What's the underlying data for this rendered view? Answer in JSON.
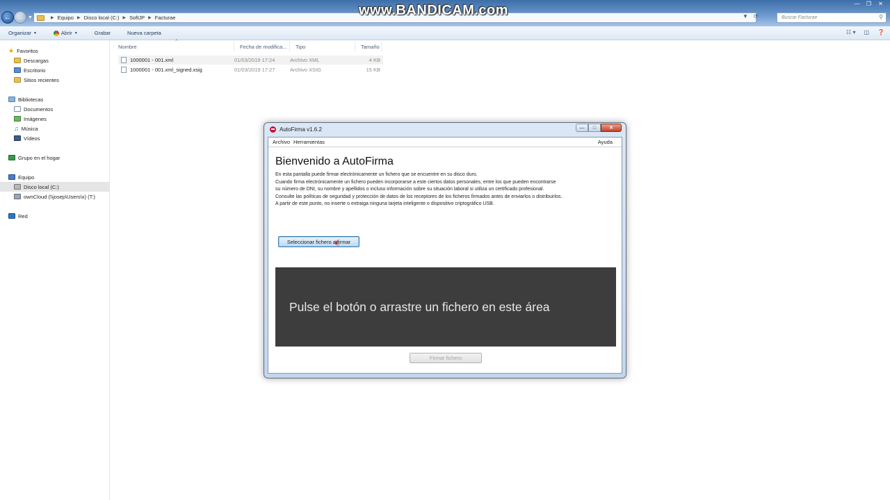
{
  "watermark": "www.BANDICAM.com",
  "explorer": {
    "breadcrumb": [
      "Equipo",
      "Disco local (C:)",
      "SoftJP",
      "Facturae"
    ],
    "search_placeholder": "Buscar Facturae",
    "commands": [
      "Organizar",
      "Abrir",
      "Grabar",
      "Nueva carpeta"
    ],
    "sidebar": {
      "favorites": {
        "label": "Favoritos",
        "items": [
          "Descargas",
          "Escritorio",
          "Sitios recientes"
        ]
      },
      "libraries": {
        "label": "Bibliotecas",
        "items": [
          "Documentos",
          "Imágenes",
          "Música",
          "Vídeos"
        ]
      },
      "homegroup": "Grupo en el hogar",
      "computer": {
        "label": "Equipo",
        "items": [
          "Disco local (C:)",
          "ownCloud (\\\\josep\\Users\\x) (T:)"
        ]
      },
      "network": "Red"
    },
    "columns": [
      "Nombre",
      "Fecha de modifica...",
      "Tipo",
      "Tamaño"
    ],
    "files": [
      {
        "name": "1000001 - 001.xml",
        "date": "01/03/2019 17:24",
        "type": "Archivo XML",
        "size": "4 KB"
      },
      {
        "name": "1000001 - 001.xml_signed.xsig",
        "date": "01/03/2019 17:27",
        "type": "Archivo XSIG",
        "size": "15 KB"
      }
    ]
  },
  "autofirma": {
    "title": "AutoFirma v1.6.2",
    "menu": {
      "archivo": "Archivo",
      "herramientas": "Herramientas",
      "ayuda": "Ayuda"
    },
    "heading": "Bienvenido a AutoFirma",
    "paragraphs": [
      "En esta pantalla puede firmar electrónicamente un fichero que se encuentre en su disco duro.",
      "Cuando firma electrónicamente un fichero pueden incorporarse a este ciertos datos personales, entre los que pueden encontrarse",
      "su número de DNI, su nombre y apellidos o incluso información sobre su situación laboral si utiliza un certificado profesional.",
      "Consulte las políticas de seguridad y protección de datos de los receptores de los ficheros firmados antes de enviarlos o distribuirlos.",
      "A partir de este punto, no inserte o extraiga ninguna tarjeta inteligente o dispositivo criptográfico USB."
    ],
    "select_button": "Seleccionar fichero a firmar",
    "drop_text": "Pulse el botón o arrastre un fichero en este área",
    "sign_button": "Firmar fichero"
  }
}
